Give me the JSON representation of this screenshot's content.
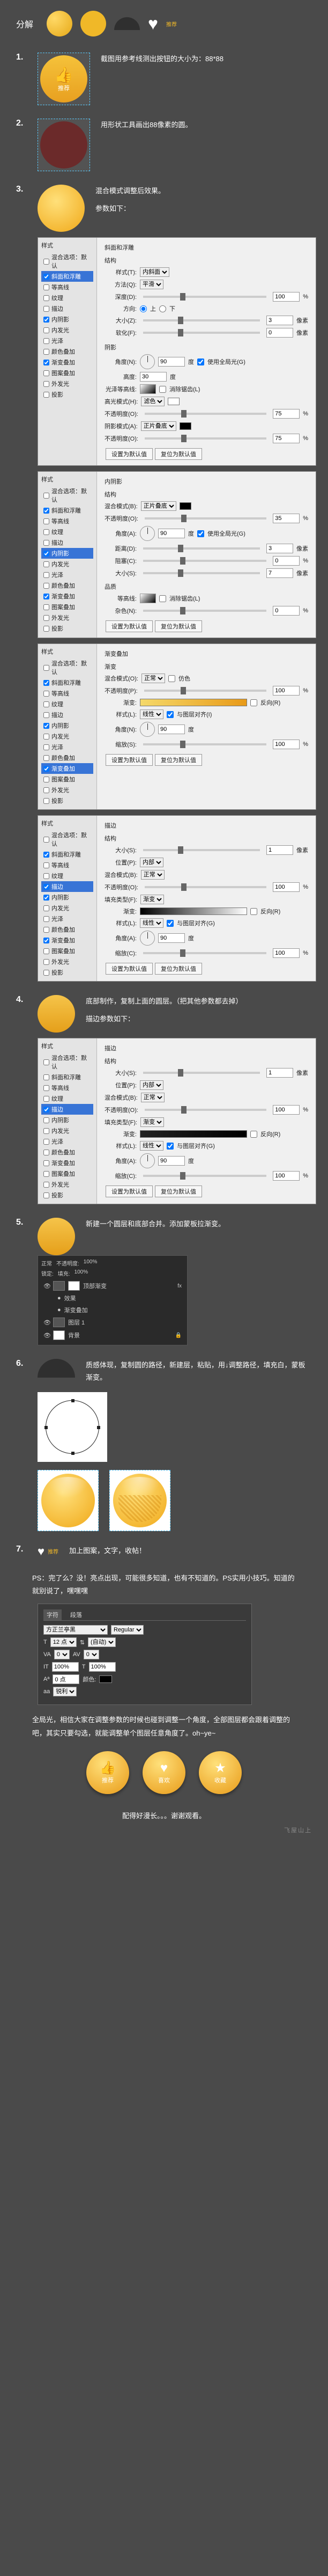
{
  "header": {
    "label": "分解",
    "tag": "推荐"
  },
  "steps": {
    "s1": {
      "num": "1.",
      "thumb_label": "推荐",
      "text": "截图用参考线测出按钮的大小为：88*88"
    },
    "s2": {
      "num": "2.",
      "text": "用形状工具画出88像素的圆。"
    },
    "s3": {
      "num": "3.",
      "text": "混合模式调整后效果。",
      "params_label": "参数如下："
    },
    "s4": {
      "num": "4.",
      "text": "底部制作，复制上面的圆层。（把其他参数都去掉）",
      "params_label": "描边参数如下："
    },
    "s5": {
      "num": "5.",
      "text": "新建一个圆层和底部合并。添加蒙板拉渐变。"
    },
    "s6": {
      "num": "6.",
      "text": "质感体现，复制圆的路径，新建层，粘贴，用↓调整路径，填充白，蒙板渐变。"
    },
    "s7": {
      "num": "7.",
      "text": "加上图案，文字，收帖！"
    }
  },
  "ps_note": "PS：完了么？没！亮点出现，可能很多知道，也有不知道的。PS实用小技巧。知道的就别说了，嘿嘿嘿",
  "global_light": "全局光，相信大家在调整参数的时候也碰到调整一个角度，全部图层都会跟着调整的吧，其实只要勾选，就能调整单个图层任意角度了。oh~ye~",
  "thanks": "配得好漫长。。。谢谢观看。",
  "watermark": "飞屋山上",
  "layer_styles": {
    "side_title": "样式",
    "items": [
      "混合选项：默认",
      "斜面和浮雕",
      "等高线",
      "纹理",
      "描边",
      "内阴影",
      "内发光",
      "光泽",
      "颜色叠加",
      "渐变叠加",
      "图案叠加",
      "外发光",
      "投影"
    ]
  },
  "panel_bevel": {
    "title": "斜面和浮雕",
    "struct": "结构",
    "style_lbl": "样式(T):",
    "style_val": "内斜面",
    "method_lbl": "方法(Q):",
    "method_val": "平滑",
    "depth_lbl": "深度(D):",
    "depth_val": "100",
    "pct": "%",
    "dir_lbl": "方向:",
    "dir_up": "上",
    "dir_down": "下",
    "size_lbl": "大小(Z):",
    "size_val": "3",
    "px": "像素",
    "soft_lbl": "软化(F):",
    "soft_val": "0",
    "shade": "阴影",
    "angle_lbl": "角度(N):",
    "angle_val": "90",
    "deg": "度",
    "global_lbl": "使用全局光(G)",
    "alt_lbl": "高度:",
    "alt_val": "30",
    "gloss_lbl": "光泽等高线:",
    "anti": "消除锯齿(L)",
    "hi_mode": "高光模式(H):",
    "hi_val": "滤色",
    "opacity": "不透明度(O):",
    "op_val": "75",
    "sh_mode": "阴影模式(A):",
    "sh_val": "正片叠底",
    "default_btn": "设置为默认值",
    "reset_btn": "复位为默认值"
  },
  "panel_inner": {
    "title": "内阴影",
    "struct": "结构",
    "blend": "混合模式(B):",
    "blend_val": "正片叠底",
    "opacity": "不透明度(O):",
    "op_val": "35",
    "angle": "角度(A):",
    "angle_val": "90",
    "global": "使用全局光(G)",
    "dist": "距离(D):",
    "dist_val": "3",
    "choke": "阻塞(C):",
    "choke_val": "0",
    "size": "大小(S):",
    "size_val": "7",
    "quality": "品质",
    "contour": "等高线:",
    "anti": "消除锯齿(L)",
    "noise": "杂色(N):",
    "noise_val": "0"
  },
  "panel_grad": {
    "title": "渐变叠加",
    "sect": "渐变",
    "blend": "混合模式(O):",
    "blend_val": "正常",
    "dither": "仿色",
    "opacity": "不透明度(P):",
    "op_val": "100",
    "grad": "渐变:",
    "reverse": "反向(R)",
    "style": "样式(L):",
    "style_val": "线性",
    "align": "与图层对齐(I)",
    "angle": "角度(N):",
    "angle_val": "90",
    "scale": "缩放(S):",
    "scale_val": "100"
  },
  "panel_stroke": {
    "title": "描边",
    "struct": "结构",
    "size": "大小(S):",
    "size_val": "1",
    "pos": "位置(P):",
    "pos_val": "内部",
    "blend": "混合模式(B):",
    "blend_val": "正常",
    "opacity": "不透明度(O):",
    "op_val": "100",
    "fill": "填充类型(F):",
    "fill_val": "渐变",
    "grad": "渐变:",
    "reverse": "反向(R)",
    "style": "样式(L):",
    "style_val": "线性",
    "align": "与图层对齐(G)",
    "angle": "角度(A):",
    "angle_val": "90",
    "scale": "缩放(C):",
    "scale_val": "100"
  },
  "layers": {
    "mode": "正常",
    "opacity_lbl": "不透明度:",
    "opacity": "100%",
    "lock": "锁定:",
    "fill_lbl": "填充:",
    "fill": "100%",
    "layer1": "顶部渐变",
    "fx": "fx",
    "effects": "效果",
    "grad_overlay": "渐变叠加",
    "layer2": "图层 1",
    "bg": "背景"
  },
  "inspector": {
    "tabs": [
      "字符",
      "段落"
    ],
    "font": "方正兰亭黑",
    "weight": "Regular",
    "size_lbl": "T",
    "size": "12 点",
    "leading": "(自动)",
    "tracking": "0",
    "kerning": "0",
    "scale_v": "100%",
    "scale_h": "100%",
    "baseline": "0 点",
    "color_lbl": "颜色:",
    "aa": "锐利"
  },
  "buttons": {
    "b1": {
      "icon": "👍",
      "label": "推荐"
    },
    "b2": {
      "icon": "♥",
      "label": "喜欢"
    },
    "b3": {
      "icon": "★",
      "label": "收藏"
    }
  }
}
